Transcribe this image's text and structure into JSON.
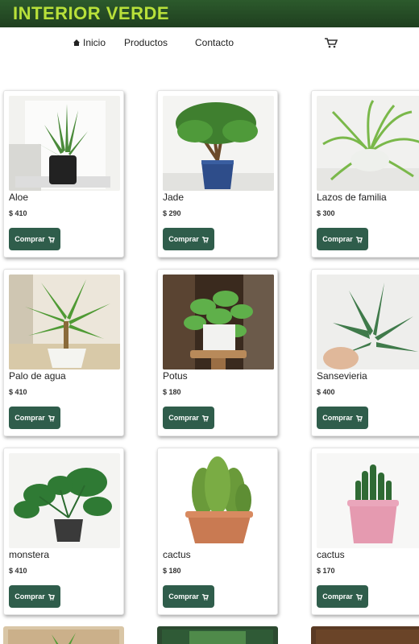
{
  "brand": "INTERIOR VERDE",
  "nav": {
    "items": [
      {
        "label": "Inicio",
        "icon": "home-icon"
      },
      {
        "label": "Productos"
      },
      {
        "label": "Contacto"
      }
    ],
    "cart_icon": "cart-icon"
  },
  "colors": {
    "header": "#1f3f1f",
    "brand": "#b8e03a",
    "button": "#2f5d4b"
  },
  "products": [
    {
      "name": "Aloe",
      "price": "$ 410",
      "button": "Comprar",
      "image": "aloe-plant"
    },
    {
      "name": "Jade",
      "price": "$ 290",
      "button": "Comprar",
      "image": "jade-plant"
    },
    {
      "name": "Lazos de familia",
      "price": "$ 300",
      "button": "Comprar",
      "image": "spider-plant"
    },
    {
      "name": "Palo de agua",
      "price": "$ 410",
      "button": "Comprar",
      "image": "dracaena-plant"
    },
    {
      "name": "Potus",
      "price": "$ 180",
      "button": "Comprar",
      "image": "pothos-plant"
    },
    {
      "name": "Sansevieria",
      "price": "$ 400",
      "button": "Comprar",
      "image": "sansevieria-plant"
    },
    {
      "name": "monstera",
      "price": "$ 410",
      "button": "Comprar",
      "image": "monstera-plant"
    },
    {
      "name": "cactus",
      "price": "$ 180",
      "button": "Comprar",
      "image": "cactus-plant"
    },
    {
      "name": "cactus",
      "price": "$ 170",
      "button": "Comprar",
      "image": "small-cactus-plant"
    }
  ]
}
